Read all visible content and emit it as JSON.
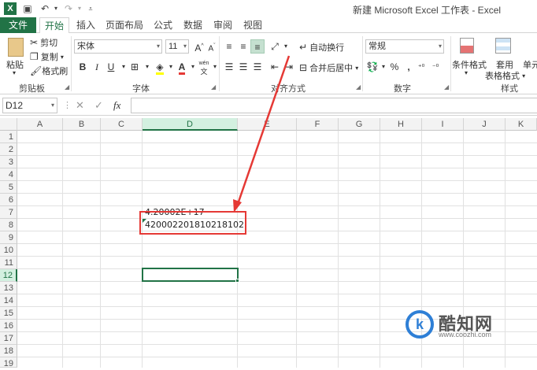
{
  "window": {
    "title": "新建 Microsoft Excel 工作表 - Excel",
    "app_icon": "X"
  },
  "quick_access": [
    {
      "name": "save-icon",
      "glyph": "💾"
    },
    {
      "name": "undo-icon",
      "glyph": "↶"
    },
    {
      "name": "redo-icon",
      "glyph": "↷"
    },
    {
      "name": "customize-icon",
      "glyph": "▾"
    }
  ],
  "tabs": [
    "文件",
    "开始",
    "插入",
    "页面布局",
    "公式",
    "数据",
    "审阅",
    "视图"
  ],
  "active_tab": "开始",
  "ribbon": {
    "clipboard": {
      "paste": "粘贴",
      "cut": "剪切",
      "copy": "复制",
      "format_painter": "格式刷",
      "label": "剪贴板"
    },
    "font": {
      "font_name": "宋体",
      "font_size": "11",
      "grow": "A",
      "shrink": "A",
      "bold": "B",
      "italic": "I",
      "underline": "U",
      "label": "字体",
      "wen": "wén",
      "wen_char": "文"
    },
    "alignment": {
      "wrap_text": "自动换行",
      "merge_center": "合并后居中",
      "label": "对齐方式"
    },
    "number": {
      "format": "常规",
      "label": "数字",
      "percent": "%",
      "comma": ","
    },
    "styles": {
      "conditional": "条件格式",
      "table_line1": "套用",
      "table_line2": "表格格式",
      "cell_styles": "单元",
      "label": "样式"
    }
  },
  "formula_bar": {
    "name_box": "D12",
    "fx": "fx",
    "content": ""
  },
  "columns": [
    "A",
    "B",
    "C",
    "D",
    "E",
    "F",
    "G",
    "H",
    "I",
    "J",
    "K"
  ],
  "selected_column": "D",
  "rows": [
    "1",
    "2",
    "3",
    "4",
    "5",
    "6",
    "7",
    "8",
    "9",
    "10",
    "11",
    "12",
    "13",
    "14",
    "15",
    "16",
    "17",
    "18",
    "19"
  ],
  "selected_row": "12",
  "cells": {
    "D7": "4.20002E+17",
    "D8": "420002201810218102"
  },
  "watermark": {
    "name": "酷知网",
    "url": "www.coozhi.com",
    "logo": "k"
  }
}
